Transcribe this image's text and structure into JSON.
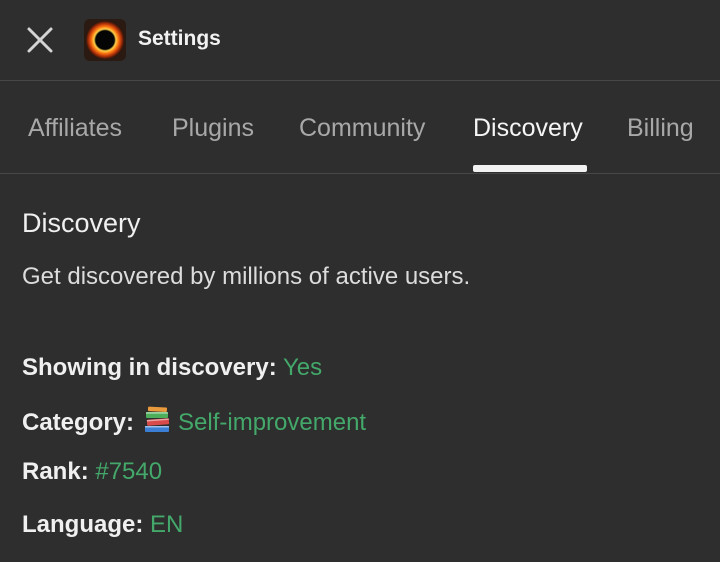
{
  "header": {
    "title": "Settings",
    "close_icon": "close-icon",
    "logo_icon": "fire-ring-logo"
  },
  "tabs": [
    {
      "label": "Affiliates",
      "active": false
    },
    {
      "label": "Plugins",
      "active": false
    },
    {
      "label": "Community",
      "active": false
    },
    {
      "label": "Discovery",
      "active": true
    },
    {
      "label": "Billing",
      "active": false
    }
  ],
  "discovery": {
    "title": "Discovery",
    "description": "Get discovered by millions of active users.",
    "showing_label": "Showing in discovery:",
    "showing_value": "Yes",
    "category_label": "Category:",
    "category_icon": "books-icon",
    "category_value": "Self-improvement",
    "rank_label": "Rank:",
    "rank_value": "#7540",
    "language_label": "Language:",
    "language_value": "EN"
  },
  "colors": {
    "background": "#2e2e2e",
    "divider": "#474747",
    "accent_green": "#43a86a",
    "tab_inactive": "#a8a8a8",
    "tab_active": "#f5f5f5"
  }
}
